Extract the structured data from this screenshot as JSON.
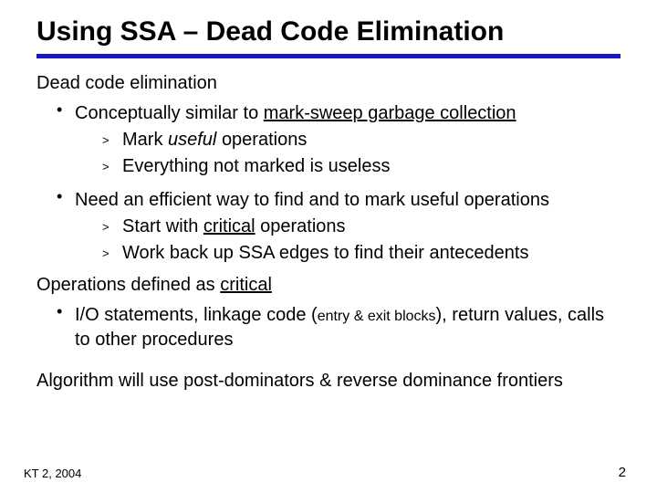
{
  "title": "Using SSA – Dead Code Elimination",
  "section1": "Dead code elimination",
  "b1a_pre": "Conceptually similar to ",
  "b1a_u": "mark-sweep garbage collection",
  "b1a_s1_pre": "Mark ",
  "b1a_s1_it": "useful ",
  "b1a_s1_post": " operations",
  "b1a_s2": "Everything not marked is useless",
  "b1b": "Need an efficient way to find and to mark useful operations",
  "b1b_s1_pre": "Start with ",
  "b1b_s1_u": "critical",
  "b1b_s1_post": " operations",
  "b1b_s2": "Work back up SSA edges to find their antecedents",
  "section2_pre": "Operations defined as ",
  "section2_u": "critical",
  "b2a_pre": "I/O statements, linkage code (",
  "b2a_small": "entry & exit blocks",
  "b2a_post": "), return values, calls to other procedures",
  "closing": "Algorithm will use post-dominators & reverse dominance frontiers",
  "footer_left": "KT 2, 2004",
  "footer_right": "2"
}
